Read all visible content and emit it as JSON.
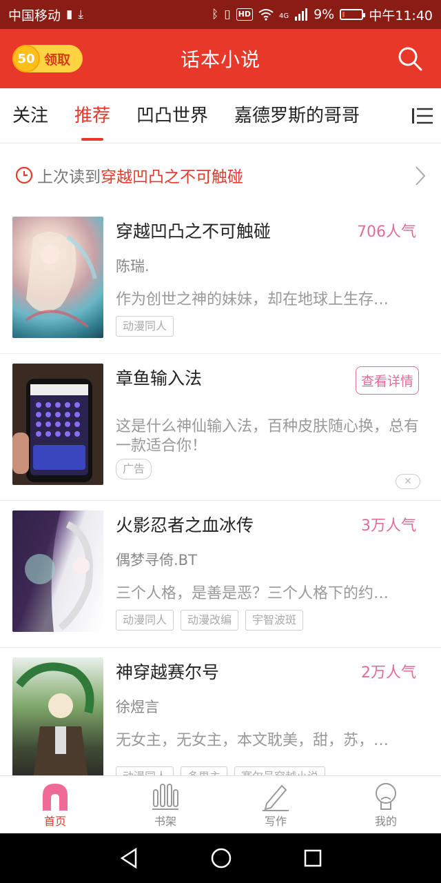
{
  "status_bar": {
    "carrier": "中国移动",
    "battery_percent": "9%",
    "network": "4G",
    "hd": "HD",
    "time": "中午11:40"
  },
  "header": {
    "coin_value": "50",
    "coin_label": "领取",
    "title": "话本小说",
    "accent": "#e8382a"
  },
  "tabs": [
    {
      "label": "关注"
    },
    {
      "label": "推荐"
    },
    {
      "label": "凹凸世界"
    },
    {
      "label": "嘉德罗斯的哥哥"
    }
  ],
  "last_read": {
    "prefix": "上次读到",
    "book": "穿越凹凸之不可触碰"
  },
  "items": [
    {
      "title": "穿越凹凸之不可触碰",
      "popularity": "706人气",
      "author": "陈瑞.",
      "desc": "作为创世之神的妹妹，却在地球上生存…",
      "tags": [
        "动漫同人"
      ]
    },
    {
      "title": "章鱼输入法",
      "action": "查看详情",
      "desc": "这是什么神仙输入法，百种皮肤随心换，总有一款适合你！",
      "tags": [
        "广告"
      ]
    },
    {
      "title": "火影忍者之血冰传",
      "popularity": "3万人气",
      "author": "偶梦寻倚.BT",
      "desc": "三个人格，是善是恶？三个人格下的约…",
      "tags": [
        "动漫同人",
        "动漫改编",
        "宇智波斑"
      ]
    },
    {
      "title": "神穿越赛尔号",
      "popularity": "2万人气",
      "author": "徐煜言",
      "desc": "无女主，无女主，本文耽美，甜，苏，…",
      "tags": [
        "动漫同人",
        "多男主",
        "赛尔号穿越小说"
      ]
    }
  ],
  "bottom_nav": [
    {
      "label": "首页",
      "icon": "home-icon"
    },
    {
      "label": "书架",
      "icon": "bookshelf-icon"
    },
    {
      "label": "写作",
      "icon": "pen-icon"
    },
    {
      "label": "我的",
      "icon": "profile-icon"
    }
  ]
}
